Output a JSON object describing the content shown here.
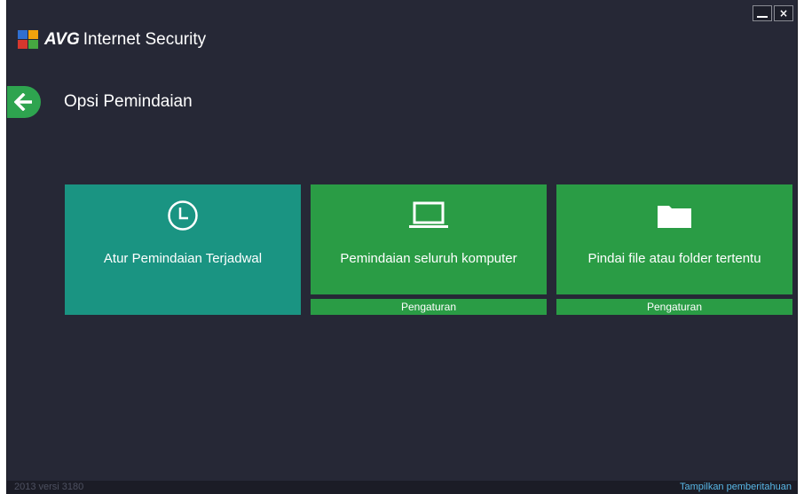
{
  "app": {
    "brand_bold": "AVG",
    "brand_rest": "Internet Security",
    "minimize_icon": "minimize-icon",
    "close_label": "×"
  },
  "page": {
    "title": "Opsi Pemindaian",
    "back_icon": "arrow-left-icon"
  },
  "tiles": [
    {
      "label": "Atur Pemindaian Terjadwal",
      "icon": "clock-icon",
      "color": "#1a9482"
    },
    {
      "label": "Pemindaian seluruh komputer",
      "icon": "laptop-icon",
      "color": "#2a9c45",
      "settings_label": "Pengaturan"
    },
    {
      "label": "Pindai file atau folder tertentu",
      "icon": "folder-icon",
      "color": "#2a9c45",
      "settings_label": "Pengaturan"
    }
  ],
  "footer": {
    "version": "2013  versi 3180",
    "notifications_link": "Tampilkan pemberitahuan"
  },
  "colors": {
    "background": "#262836",
    "accent_green": "#2a9c45",
    "accent_teal": "#1a9482",
    "link": "#58b7e6"
  }
}
